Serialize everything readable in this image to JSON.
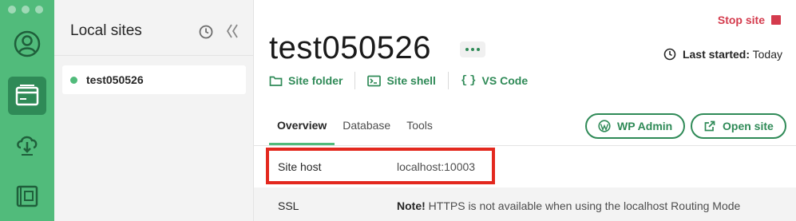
{
  "sidebar": {
    "title": "Local sites",
    "sites": [
      {
        "name": "test050526",
        "status": "running",
        "status_color": "#51bb7b"
      }
    ]
  },
  "rail": {
    "items": [
      {
        "icon": "user-avatar-icon",
        "active": false
      },
      {
        "icon": "browser-window-icon",
        "active": true
      },
      {
        "icon": "cloud-download-icon",
        "active": false
      },
      {
        "icon": "blueprint-icon",
        "active": false
      }
    ]
  },
  "site": {
    "title": "test050526",
    "stop_label": "Stop site",
    "last_started_label": "Last started:",
    "last_started_value": "Today",
    "actions": [
      {
        "label": "Site folder",
        "icon": "folder-icon"
      },
      {
        "label": "Site shell",
        "icon": "terminal-icon"
      },
      {
        "label": "VS Code",
        "icon": "code-braces-icon"
      }
    ],
    "tabs": [
      {
        "label": "Overview",
        "active": true
      },
      {
        "label": "Database",
        "active": false
      },
      {
        "label": "Tools",
        "active": false
      }
    ],
    "buttons": {
      "wp_admin": "WP Admin",
      "open_site": "Open site"
    },
    "details": [
      {
        "label": "Site host",
        "value": "localhost:10003"
      },
      {
        "label": "SSL",
        "value_bold": "Note!",
        "value": " HTTPS is not available when using the localhost Routing Mode"
      }
    ]
  },
  "colors": {
    "brand_green": "#51bb7b",
    "dark_green": "#2f8a57",
    "stop_red": "#d43b4d",
    "highlight_red": "#e3281e"
  }
}
